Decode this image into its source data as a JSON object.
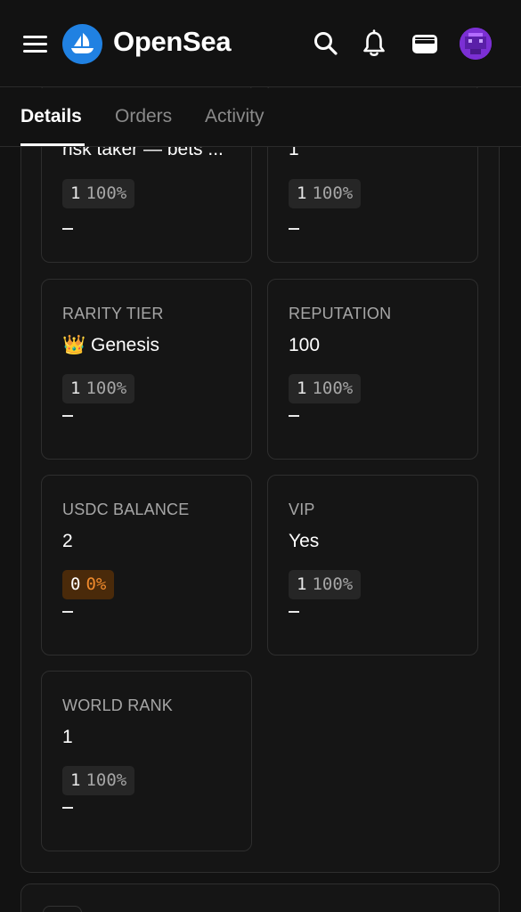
{
  "header": {
    "brand": "OpenSea",
    "brand_color": "#2081e2",
    "icons": [
      "menu-icon",
      "opensea-logo-icon",
      "search-icon",
      "bell-icon",
      "wallet-icon",
      "avatar"
    ]
  },
  "tabs": [
    {
      "label": "Details",
      "active": true
    },
    {
      "label": "Orders",
      "active": false
    },
    {
      "label": "Activity",
      "active": false
    }
  ],
  "traits": [
    {
      "label": "",
      "value": "risk taker — bets ...",
      "count": "1",
      "percent": "100%",
      "floor": "–",
      "partial": true
    },
    {
      "label": "",
      "value": "1",
      "count": "1",
      "percent": "100%",
      "floor": "–",
      "partial": true
    },
    {
      "label": "RARITY TIER",
      "value": "👑 Genesis",
      "count": "1",
      "percent": "100%",
      "floor": "–"
    },
    {
      "label": "REPUTATION",
      "value": "100",
      "count": "1",
      "percent": "100%",
      "floor": "–"
    },
    {
      "label": "USDC BALANCE",
      "value": "2",
      "count": "0",
      "percent": "0%",
      "floor": "–",
      "highlight": true
    },
    {
      "label": "VIP",
      "value": "Yes",
      "count": "1",
      "percent": "100%",
      "floor": "–"
    },
    {
      "label": "WORLD RANK",
      "value": "1",
      "count": "1",
      "percent": "100%",
      "floor": "–"
    }
  ],
  "colors": {
    "background": "#121212",
    "card_border": "#2e2e2e",
    "warning_pct": "#f08a2c"
  }
}
